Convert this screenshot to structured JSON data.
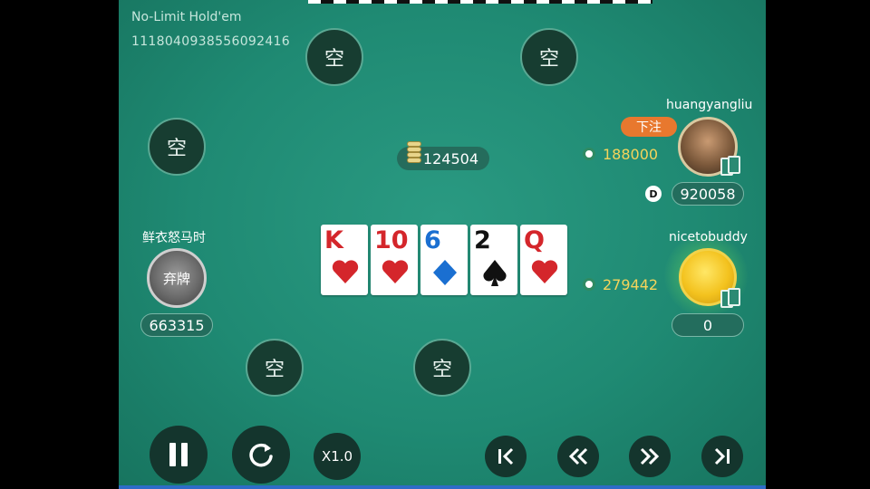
{
  "game": {
    "title": "No-Limit Hold'em",
    "id": "1118040938556092416"
  },
  "empty_seat_label": "空",
  "pot": {
    "amount": "124504"
  },
  "board": [
    {
      "rank": "K",
      "suit": "heart",
      "color": "#d4262b"
    },
    {
      "rank": "10",
      "suit": "heart",
      "color": "#d4262b"
    },
    {
      "rank": "6",
      "suit": "diamond",
      "color": "#1a6fd1"
    },
    {
      "rank": "2",
      "suit": "spade",
      "color": "#111111"
    },
    {
      "rank": "Q",
      "suit": "heart",
      "color": "#d4262b"
    }
  ],
  "players": [
    {
      "seat": "right-top",
      "name": "huangyangliu",
      "bet": "188000",
      "stack": "920058",
      "action": "下注",
      "dealer": "D"
    },
    {
      "seat": "right-middle",
      "name": "nicetobuddy",
      "bet": "279442",
      "stack": "0"
    },
    {
      "seat": "left",
      "name": "鲜衣怒马时",
      "status": "弃牌",
      "stack": "663315"
    }
  ],
  "controls": {
    "speed": "X1.0",
    "icons": [
      "pause-icon",
      "replay-icon",
      "skip-to-start-icon",
      "rewind-icon",
      "fast-forward-icon",
      "skip-to-end-icon"
    ]
  },
  "colors": {
    "table": "#1f8a73",
    "seat_bg": "#173d31",
    "bet_text": "#f5d45b",
    "action_tag": "#e8782e"
  }
}
